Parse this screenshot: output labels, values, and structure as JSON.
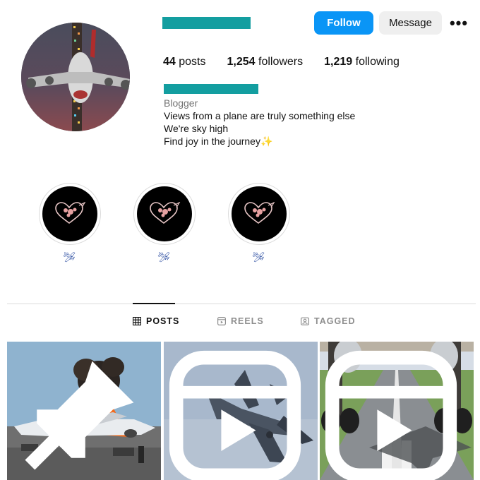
{
  "header": {
    "follow_label": "Follow",
    "message_label": "Message",
    "more_label": "•••"
  },
  "stats": {
    "posts_count": "44",
    "posts_label": "posts",
    "followers_count": "1,254",
    "followers_label": "followers",
    "following_count": "1,219",
    "following_label": "following"
  },
  "bio": {
    "category": "Blogger",
    "lines": [
      "Views from a plane are truly something else",
      "We're sky high",
      "Find joy in the journey"
    ],
    "emoji": "✨"
  },
  "highlights": [
    {
      "label": "🛩"
    },
    {
      "label": "🛩"
    },
    {
      "label": "🛩"
    }
  ],
  "tabs": [
    {
      "label": "POSTS",
      "active": true,
      "icon": "grid-icon"
    },
    {
      "label": "REELS",
      "active": false,
      "icon": "reels-icon"
    },
    {
      "label": "TAGGED",
      "active": false,
      "icon": "tagged-icon"
    }
  ],
  "posts": [
    {
      "badge": "pin-icon"
    },
    {
      "badge": "reels-icon"
    },
    {
      "badge": "reels-icon"
    }
  ],
  "colors": {
    "follow_button": "#0a95f6",
    "redaction": "#139ea0",
    "divider": "#dbdbdb"
  }
}
